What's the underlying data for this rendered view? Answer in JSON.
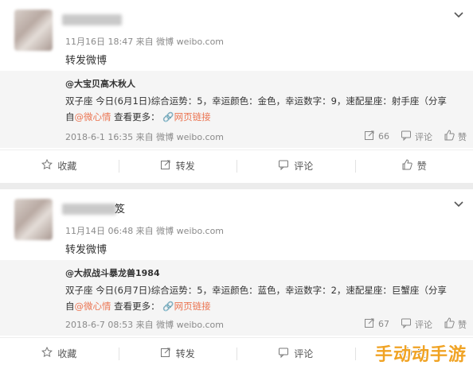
{
  "posts": [
    {
      "name_suffix": "",
      "meta": "11月16日 18:47 来自 微博 weibo.com",
      "text": "转发微博",
      "quote": {
        "user": "@大宝贝高木秋人",
        "line1": "双子座 今日(6月1日)综合运势：5，幸运颜色：金色，幸运数字：9，速配星座：射手座（分享",
        "line2_prefix": "自",
        "line2_link": "@微心情",
        "line2_more": "查看更多：",
        "line2_web": "网页链接",
        "meta": "2018-6-1 16:35 来自 微博 weibo.com",
        "repost_count": "66",
        "comment_label": "评论",
        "like_label": "赞"
      },
      "actions": {
        "fav": "收藏",
        "repost": "转发",
        "comment": "评论",
        "like": "赞"
      }
    },
    {
      "name_suffix": "笈",
      "meta": "11月14日 06:48 来自 微博 weibo.com",
      "text": "转发微博",
      "quote": {
        "user": "@大叔战斗暴龙兽1984",
        "line1": "双子座 今日(6月7日)综合运势：5，幸运颜色：蓝色，幸运数字：2，速配星座：巨蟹座（分享",
        "line2_prefix": "自",
        "line2_link": "@微心情",
        "line2_more": "查看更多：",
        "line2_web": "网页链接",
        "meta": "2018-6-7 08:53 来自 微博 weibo.com",
        "repost_count": "67",
        "comment_label": "评论",
        "like_label": "赞"
      },
      "actions": {
        "fav": "收藏",
        "repost": "转发",
        "comment": "评论",
        "like": "赞"
      }
    }
  ],
  "watermark": "手动动手游",
  "colors": {
    "link": "#eb7350",
    "meta": "#8a8a8a",
    "watermark": "#f0a324"
  }
}
